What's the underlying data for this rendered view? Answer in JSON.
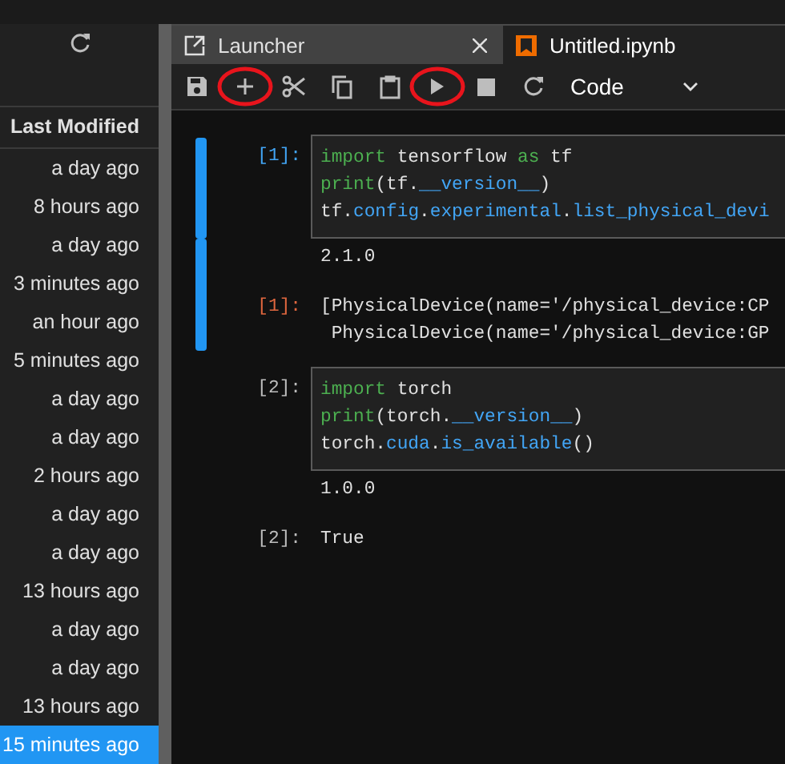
{
  "sidebar": {
    "column_header": "Last Modified",
    "items": [
      {
        "modified": "a day ago",
        "selected": false
      },
      {
        "modified": "8 hours ago",
        "selected": false
      },
      {
        "modified": "a day ago",
        "selected": false
      },
      {
        "modified": "3 minutes ago",
        "selected": false
      },
      {
        "modified": "an hour ago",
        "selected": false
      },
      {
        "modified": "5 minutes ago",
        "selected": false
      },
      {
        "modified": "a day ago",
        "selected": false
      },
      {
        "modified": "a day ago",
        "selected": false
      },
      {
        "modified": "2 hours ago",
        "selected": false
      },
      {
        "modified": "a day ago",
        "selected": false
      },
      {
        "modified": "a day ago",
        "selected": false
      },
      {
        "modified": "13 hours ago",
        "selected": false
      },
      {
        "modified": "a day ago",
        "selected": false
      },
      {
        "modified": "a day ago",
        "selected": false
      },
      {
        "modified": "13 hours ago",
        "selected": false
      },
      {
        "modified": "15 minutes ago",
        "selected": true
      }
    ]
  },
  "tabs": [
    {
      "label": "Launcher",
      "kind": "launcher",
      "selected": false,
      "closable": true
    },
    {
      "label": "Untitled.ipynb",
      "kind": "notebook",
      "selected": true
    }
  ],
  "toolbar": {
    "buttons": [
      {
        "kind": "save",
        "circled": false
      },
      {
        "kind": "insert",
        "circled": true
      },
      {
        "kind": "cut",
        "circled": false
      },
      {
        "kind": "copy",
        "circled": false
      },
      {
        "kind": "paste",
        "circled": false
      },
      {
        "kind": "run",
        "circled": true
      },
      {
        "kind": "stop",
        "circled": false
      },
      {
        "kind": "restart",
        "circled": false
      }
    ],
    "cell_type": "Code"
  },
  "cells": [
    {
      "selected": true,
      "prompt": "[1]:",
      "source": [
        [
          {
            "text": "import",
            "kind": "keyword"
          },
          {
            "text": " tensorflow ",
            "kind": "plain"
          },
          {
            "text": "as",
            "kind": "keyword"
          },
          {
            "text": " tf",
            "kind": "plain"
          }
        ],
        [
          {
            "text": "print",
            "kind": "keyword"
          },
          {
            "text": "(tf.",
            "kind": "plain"
          },
          {
            "text": "__version__",
            "kind": "attr"
          },
          {
            "text": ")",
            "kind": "plain"
          }
        ],
        [
          {
            "text": "tf.",
            "kind": "plain"
          },
          {
            "text": "config",
            "kind": "attr"
          },
          {
            "text": ".",
            "kind": "plain"
          },
          {
            "text": "experimental",
            "kind": "attr"
          },
          {
            "text": ".",
            "kind": "plain"
          },
          {
            "text": "list_physical_devi",
            "kind": "attr"
          }
        ]
      ],
      "outputs": [
        {
          "kind": "stream",
          "lines": [
            "2.1.0"
          ]
        },
        {
          "kind": "result",
          "prompt": "[1]:",
          "lines": [
            "[PhysicalDevice(name='/physical_device:CP",
            " PhysicalDevice(name='/physical_device:GP"
          ]
        }
      ]
    },
    {
      "selected": false,
      "prompt": "[2]:",
      "source": [
        [
          {
            "text": "import",
            "kind": "keyword"
          },
          {
            "text": " torch",
            "kind": "plain"
          }
        ],
        [
          {
            "text": "print",
            "kind": "keyword"
          },
          {
            "text": "(torch.",
            "kind": "plain"
          },
          {
            "text": "__version__",
            "kind": "attr"
          },
          {
            "text": ")",
            "kind": "plain"
          }
        ],
        [
          {
            "text": "torch.",
            "kind": "plain"
          },
          {
            "text": "cuda",
            "kind": "attr"
          },
          {
            "text": ".",
            "kind": "plain"
          },
          {
            "text": "is_available",
            "kind": "attr"
          },
          {
            "text": "()",
            "kind": "plain"
          }
        ]
      ],
      "outputs": [
        {
          "kind": "stream",
          "lines": [
            "1.0.0"
          ]
        },
        {
          "kind": "result",
          "prompt": "[2]:",
          "lines": [
            "True"
          ]
        }
      ]
    }
  ]
}
